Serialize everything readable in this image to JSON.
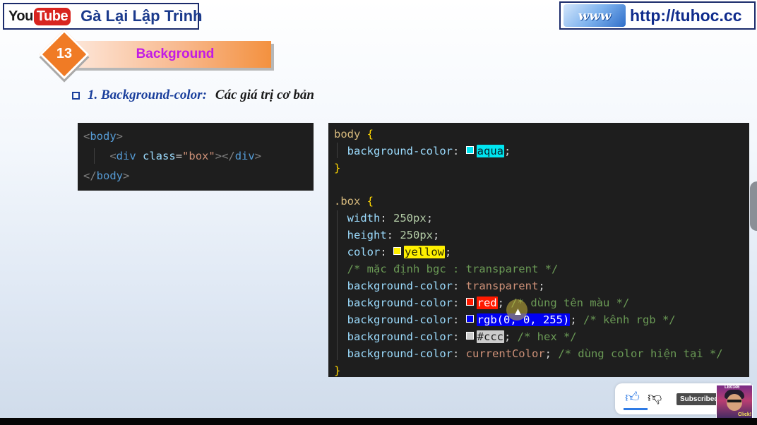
{
  "header": {
    "youtube_you": "You",
    "youtube_tube": "Tube",
    "channel_name": "Gà Lại Lập Trình",
    "www_badge": "www",
    "url": "http://tuhoc.cc"
  },
  "slide": {
    "number": "13",
    "title": "Background"
  },
  "heading": {
    "number": "1. Background-color:",
    "rest": "Các giá trị cơ bản"
  },
  "html_code": {
    "body_open": "body",
    "div_tag": "div",
    "class_attr": "class",
    "class_value": "\"box\"",
    "div_close": "div",
    "body_close": "body"
  },
  "css_code": {
    "body_selector": "body",
    "body_prop": "background-color",
    "body_val": "aqua",
    "box_selector": ".box",
    "width_prop": "width",
    "width_val": "250px",
    "height_prop": "height",
    "height_val": "250px",
    "color_prop": "color",
    "color_val": "yellow",
    "comment_default": "/* mặc định bgc : transparent */",
    "bg_prop": "background-color",
    "bg_transparent": "transparent",
    "bg_red": "red",
    "comment_red": "/* dùng tên màu */",
    "bg_rgb": "rgb(0, 0, 255)",
    "comment_rgb": "/* kênh rgb */",
    "bg_hex": "#ccc",
    "comment_hex": "/* hex */",
    "bg_current": "currentColor",
    "comment_current": "/* dùng color hiện tại */"
  },
  "colors": {
    "aqua": "#00e5f0",
    "yellow": "#fff000",
    "red": "#ff1a00",
    "blue": "#0000f0",
    "ccc": "#cccccc"
  },
  "widgets": {
    "like_icon": "thumbs-up-icon",
    "dislike_icon": "thumbs-down-icon",
    "subscribed": "Subscribed",
    "avatar_count": "LB0346",
    "avatar_click": "Click!"
  }
}
